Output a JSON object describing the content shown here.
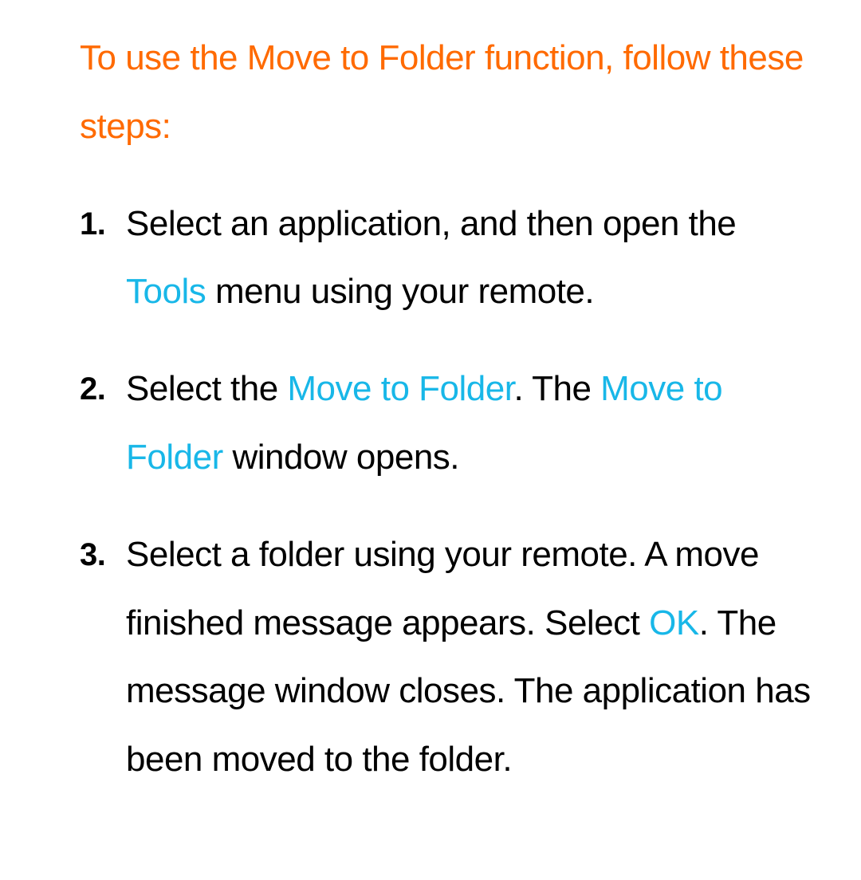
{
  "heading": "To use the Move to Folder function, follow these steps:",
  "steps": [
    {
      "parts": [
        {
          "text": "Select an application, and then open the "
        },
        {
          "text": "Tools",
          "hl": true
        },
        {
          "text": " menu using your remote."
        }
      ]
    },
    {
      "parts": [
        {
          "text": "Select the "
        },
        {
          "text": "Move to Folder",
          "hl": true
        },
        {
          "text": ". The "
        },
        {
          "text": "Move to Folder",
          "hl": true
        },
        {
          "text": " window opens."
        }
      ]
    },
    {
      "parts": [
        {
          "text": "Select a folder using your remote. A move finished message appears. Select "
        },
        {
          "text": "OK",
          "hl": true
        },
        {
          "text": ". The message window closes. The application has been moved to the folder."
        }
      ]
    }
  ]
}
